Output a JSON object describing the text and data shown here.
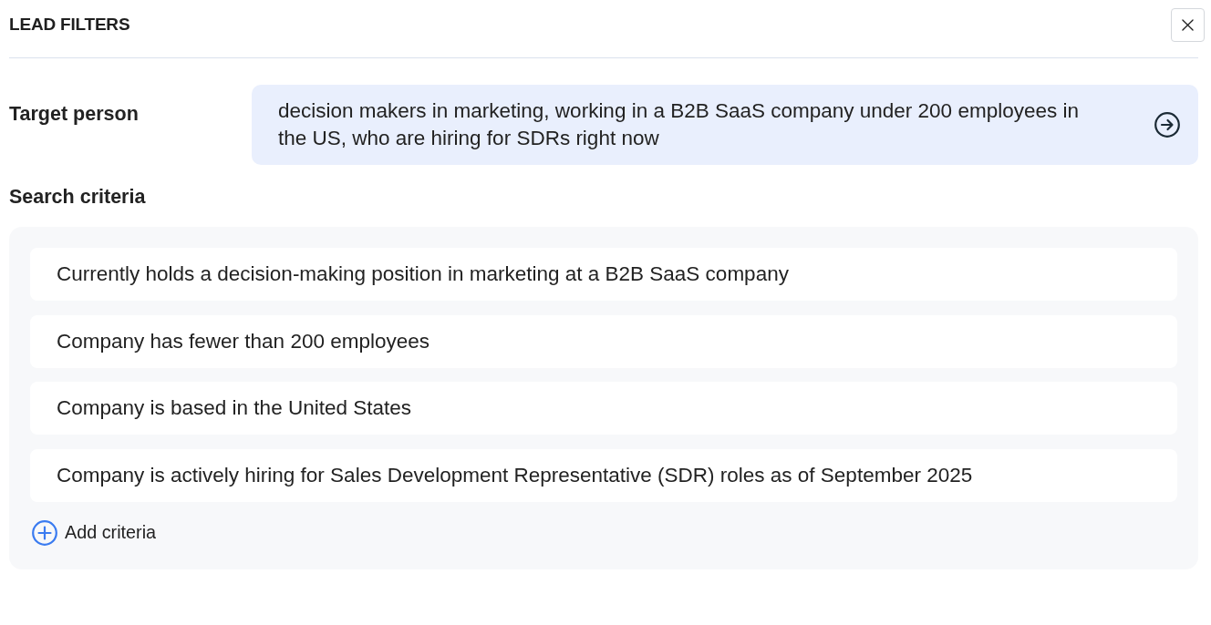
{
  "header": {
    "title": "LEAD FILTERS"
  },
  "target_person": {
    "label": "Target person",
    "value": "decision makers in marketing, working in a B2B SaaS company under 200 employees in the US, who are hiring for SDRs right now"
  },
  "search_criteria": {
    "label": "Search criteria",
    "items": [
      "Currently holds a decision-making position in marketing at a B2B SaaS company",
      "Company has fewer than 200 employees",
      "Company is based in the United States",
      "Company is actively hiring for Sales Development Representative (SDR) roles as of September 2025"
    ],
    "add_button": "Add criteria"
  }
}
